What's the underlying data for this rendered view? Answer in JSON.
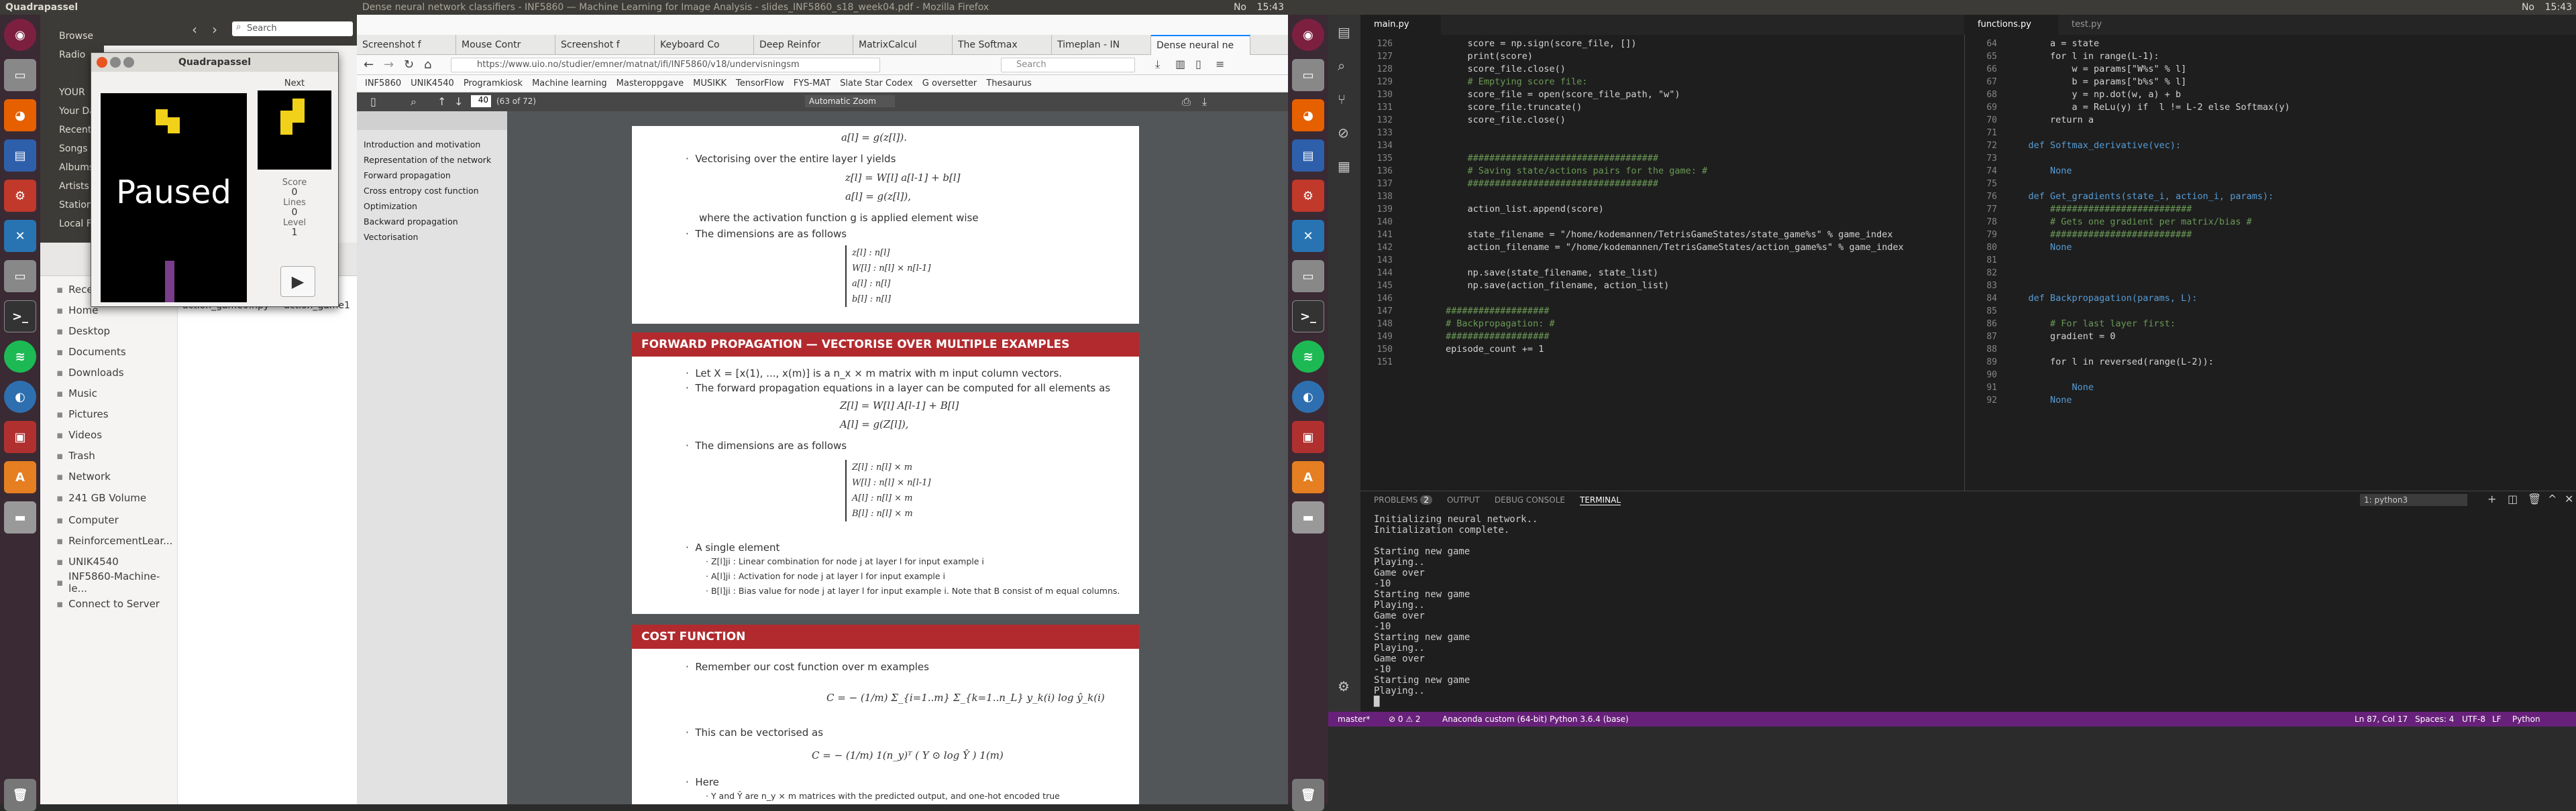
{
  "topbar_left": {
    "app": "Quadrapassel",
    "firefox_title": "Dense neural network classifiers - INF5860 — Machine Learning for Image Analysis - slides_INF5860_s18_week04.pdf - Mozilla Firefox",
    "time": "15:43",
    "kb": "No"
  },
  "topbar_right": {
    "time": "15:43",
    "kb": "No"
  },
  "quadrapassel": {
    "title": "Quadrapassel",
    "next_label": "Next",
    "paused": "Paused",
    "score_label": "Score",
    "score": "0",
    "lines_label": "Lines",
    "lines": "0",
    "level_label": "Level",
    "level": "1"
  },
  "rhythmbox": {
    "items": [
      "Browse",
      "Radio",
      "",
      "YOUR",
      "Your Da",
      "Recent",
      "Songs",
      "Albums",
      "Artists",
      "Station",
      "Local F"
    ]
  },
  "files": {
    "search_placeholder": "Search",
    "sidebar": [
      "Recent",
      "Home",
      "Desktop",
      "Documents",
      "Downloads",
      "Music",
      "Pictures",
      "Videos",
      "Trash",
      "Network",
      "241 GB Volume",
      "Computer",
      "ReinforcementLear...",
      "UNIK4540",
      "INF5860-Machine-le...",
      "Connect to Server"
    ],
    "files": [
      "action_game0.npy",
      "action_game1"
    ]
  },
  "firefox": {
    "tabs": [
      "Screenshot f",
      "Mouse Contr",
      "Screenshot f",
      "Keyboard Co",
      "Deep Reinfor",
      "MatrixCalcul",
      "The Softmax",
      "Timeplan - IN",
      "Dense neural ne"
    ],
    "url": "https://www.uio.no/studier/emner/matnat/ifi/INF5860/v18/undervisningsm",
    "search": "Search",
    "bookmarks": [
      "INF5860",
      "UNIK4540",
      "Programkiosk",
      "Machine learning",
      "Masteroppgave",
      "MUSIKK",
      "TensorFlow",
      "FYS-MAT",
      "Slate Star Codex",
      "G oversetter",
      "Thesaurus"
    ],
    "page": "40",
    "page_of": "(63 of 72)",
    "zoom": "Automatic Zoom",
    "outline": [
      "Introduction and motivation",
      "Representation of the network",
      "Forward propagation",
      "Cross entropy cost function",
      "Optimization",
      "Backward propagation",
      "Vectorisation"
    ]
  },
  "slide1": {
    "eq_top": "a[l] = g(z[l]).",
    "b1": "Vectorising over the entire layer l yields",
    "eq1": "z[l] = W[l] a[l-1] + b[l]",
    "eq2": "a[l] = g(z[l]),",
    "b2": "where the activation function g is applied element wise",
    "b3": "The dimensions are as follows",
    "dims": [
      "z[l]   : n[l]",
      "W[l]   : n[l] × n[l-1]",
      "a[l]   : n[l]",
      "b[l]   : n[l]"
    ]
  },
  "slide2": {
    "title": "FORWARD PROPAGATION — VECTORISE OVER MULTIPLE EXAMPLES",
    "b1": "Let X = [x(1), ..., x(m)] is a n_x × m matrix with m input column vectors.",
    "b2": "The forward propagation equations in a layer can be computed for all elements as",
    "eq1": "Z[l] = W[l] A[l-1] + B[l]",
    "eq2": "A[l] = g(Z[l]),",
    "b3": "The dimensions are as follows",
    "dims": [
      "Z[l]   : n[l] × m",
      "W[l]   : n[l] × n[l-1]",
      "A[l]   : n[l] × m",
      "B[l]   : n[l] × m"
    ],
    "b4": "A single element",
    "s1": "Z[l]ji : Linear combination for node j at layer l for input example i",
    "s2": "A[l]ji : Activation for node j at layer l for input example i",
    "s3": "B[l]ji : Bias value for node j at layer l for input example i. Note that B consist of m equal columns."
  },
  "slide3": {
    "title": "COST FUNCTION",
    "b1": "Remember our cost function over m examples",
    "eq1": "C = − (1/m) Σ_{i=1..m} Σ_{k=1..n_L} y_k(i) log ŷ_k(i)",
    "b2": "This can be vectorised as",
    "eq2": "C = − (1/m) 1(n_y)ᵀ ( Y ⊙ log Ŷ ) 1(m)",
    "b3": "Here",
    "s1": "Y and Ŷ are n_y × m matrices with the predicted output, and one-hot encoded true"
  },
  "vscode": {
    "tab1": "main.py",
    "tab2": "functions.py",
    "tab3": "test.py",
    "left_lines": [
      "126",
      "127",
      "128",
      "129",
      "130",
      "131",
      "132",
      "133",
      "134",
      "135",
      "136",
      "137",
      "138",
      "139",
      "140",
      "141",
      "142",
      "143",
      "144",
      "145",
      "146",
      "147",
      "148",
      "149",
      "150",
      "151"
    ],
    "left_code": [
      "            score = np.sign(score_file, [])",
      "            print(score)",
      "            score_file.close()",
      "            # Emptying score file:",
      "            score_file = open(score_file_path, \"w\")",
      "            score_file.truncate()",
      "            score_file.close()",
      "",
      "",
      "            ###################################",
      "            # Saving state/actions pairs for the game: #",
      "            ###################################",
      "",
      "            action_list.append(score)",
      "",
      "            state_filename = \"/home/kodemannen/TetrisGameStates/state_game%s\" % game_index",
      "            action_filename = \"/home/kodemannen/TetrisGameStates/action_game%s\" % game_index",
      "",
      "            np.save(state_filename, state_list)",
      "            np.save(action_filename, action_list)",
      "",
      "        ###################",
      "        # Backpropagation: #",
      "        ###################",
      "        episode_count += 1",
      ""
    ],
    "right_lines": [
      "64",
      "65",
      "66",
      "67",
      "68",
      "69",
      "70",
      "71",
      "72",
      "73",
      "74",
      "75",
      "76",
      "77",
      "78",
      "79",
      "80",
      "81",
      "82",
      "83",
      "84",
      "85",
      "86",
      "87",
      "88",
      "89",
      "90",
      "91",
      "92"
    ],
    "right_code": [
      "        a = state",
      "        for l in range(L-1):",
      "            w = params[\"W%s\" % l]",
      "            b = params[\"b%s\" % l]",
      "            y = np.dot(w, a) + b",
      "            a = ReLu(y) if  l != L-2 else Softmax(y)",
      "        return a",
      "",
      "    def Softmax_derivative(vec):",
      "",
      "        None",
      "",
      "    def Get_gradients(state_i, action_i, params):",
      "        ##########################",
      "        # Gets one gradient per matrix/bias #",
      "        ##########################",
      "        None",
      "",
      "",
      "",
      "    def Backpropagation(params, L):",
      "",
      "        # For last layer first:",
      "        gradient = 0",
      "",
      "        for l in reversed(range(L-2)):",
      "",
      "            None",
      "        None"
    ],
    "panel_tabs": [
      "PROBLEMS",
      "OUTPUT",
      "DEBUG CONSOLE",
      "TERMINAL"
    ],
    "problems_count": "2",
    "terminal_select": "1: python3",
    "terminal": [
      "Initializing neural network..",
      "Initialization complete.",
      "",
      "Starting new game",
      "Playing..",
      "Game over",
      "-10",
      "Starting new game",
      "Playing..",
      "Game over",
      "-10",
      "Starting new game",
      "Playing..",
      "Game over",
      "-10",
      "Starting new game",
      "Playing..",
      "█"
    ],
    "status_left": [
      "master*",
      "⊘ 0 ⚠ 2",
      "Anaconda custom (64-bit) Python 3.6.4 (base)"
    ],
    "status_right": [
      "Ln 87, Col 17",
      "Spaces: 4",
      "UTF-8",
      "LF",
      "Python"
    ]
  }
}
